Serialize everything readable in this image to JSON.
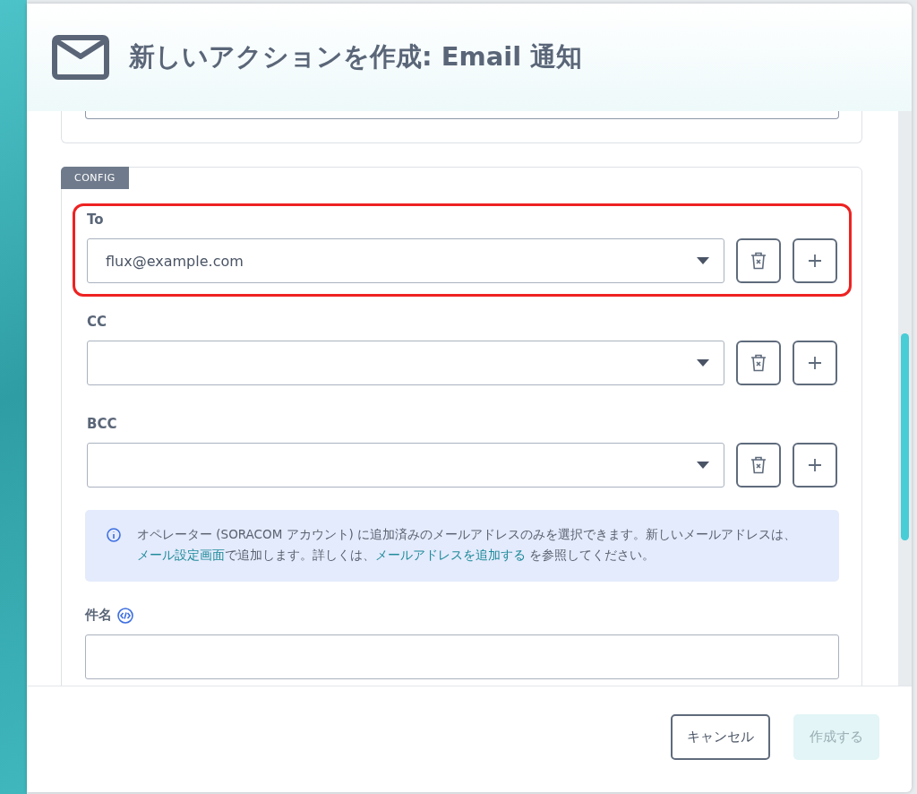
{
  "dialog": {
    "title": "新しいアクションを作成: Email 通知"
  },
  "config": {
    "tag": "CONFIG",
    "rows": [
      {
        "label": "To",
        "value": "flux@example.com",
        "highlighted": true
      },
      {
        "label": "CC",
        "value": "",
        "highlighted": false
      },
      {
        "label": "BCC",
        "value": "",
        "highlighted": false
      }
    ],
    "info": {
      "text_1": "オペレーター (SORACOM アカウント) に追加済みのメールアドレスのみを選択できます。新しいメールアドレスは、",
      "link_1": "メール設定画面",
      "text_2": "で追加します。詳しくは、",
      "link_2": "メールアドレスを追加する",
      "text_3": " を参照してください。"
    },
    "subject": {
      "label": "件名"
    }
  },
  "footer": {
    "buttons": [
      {
        "label": "キャンセル",
        "disabled": false
      },
      {
        "label": "作成する",
        "disabled": true
      }
    ]
  }
}
